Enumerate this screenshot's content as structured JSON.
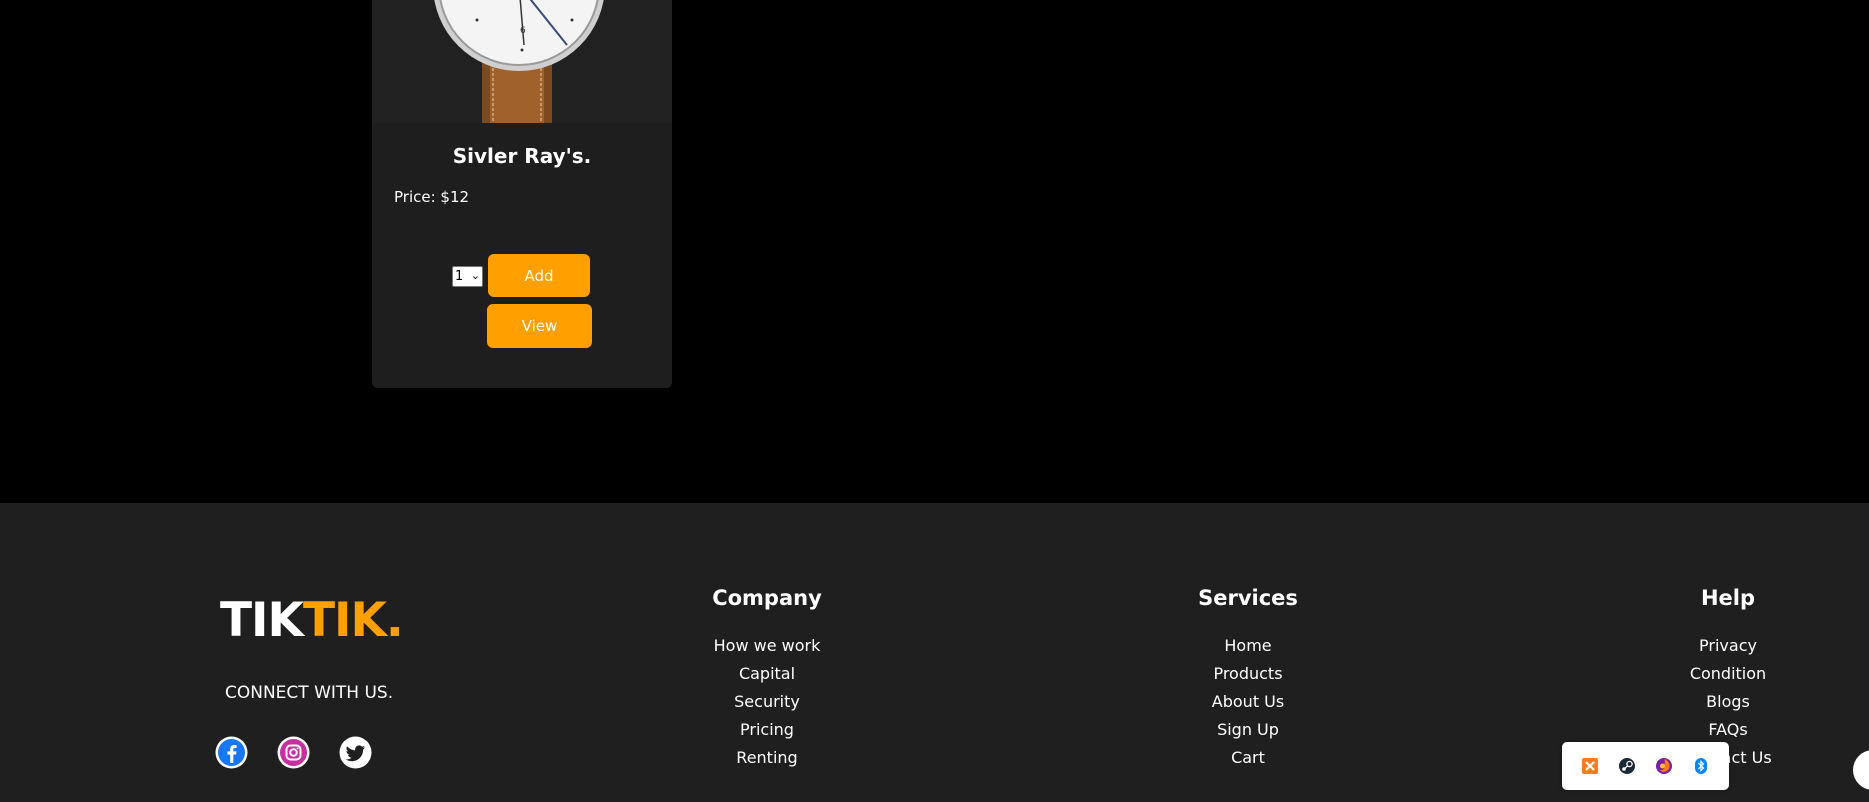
{
  "product": {
    "name": "Sivler Ray's.",
    "price": "Price: $12",
    "quantity": "1",
    "add_label": "Add",
    "view_label": "View",
    "image_icon": "wristwatch-image"
  },
  "footer": {
    "logo_part1": "TIK",
    "logo_part2": "TIK.",
    "connect_text": "CONNECT WITH US.",
    "social": [
      "facebook-icon",
      "instagram-icon",
      "twitter-icon"
    ],
    "columns": [
      {
        "heading": "Company",
        "links": [
          "How we work",
          "Capital",
          "Security",
          "Pricing",
          "Renting"
        ]
      },
      {
        "heading": "Services",
        "links": [
          "Home",
          "Products",
          "About Us",
          "Sign Up",
          "Cart"
        ]
      },
      {
        "heading": "Help",
        "links": [
          "Privacy",
          "Condition",
          "Blogs",
          "FAQs",
          "Contact Us"
        ]
      }
    ]
  },
  "tray": {
    "icons": [
      "xampp-icon",
      "steam-icon",
      "firefox-icon",
      "bluetooth-icon"
    ]
  },
  "colors": {
    "accent": "#ffa000",
    "background": "#000000",
    "card": "#1e1e1e",
    "footer": "#1f1f1f"
  }
}
